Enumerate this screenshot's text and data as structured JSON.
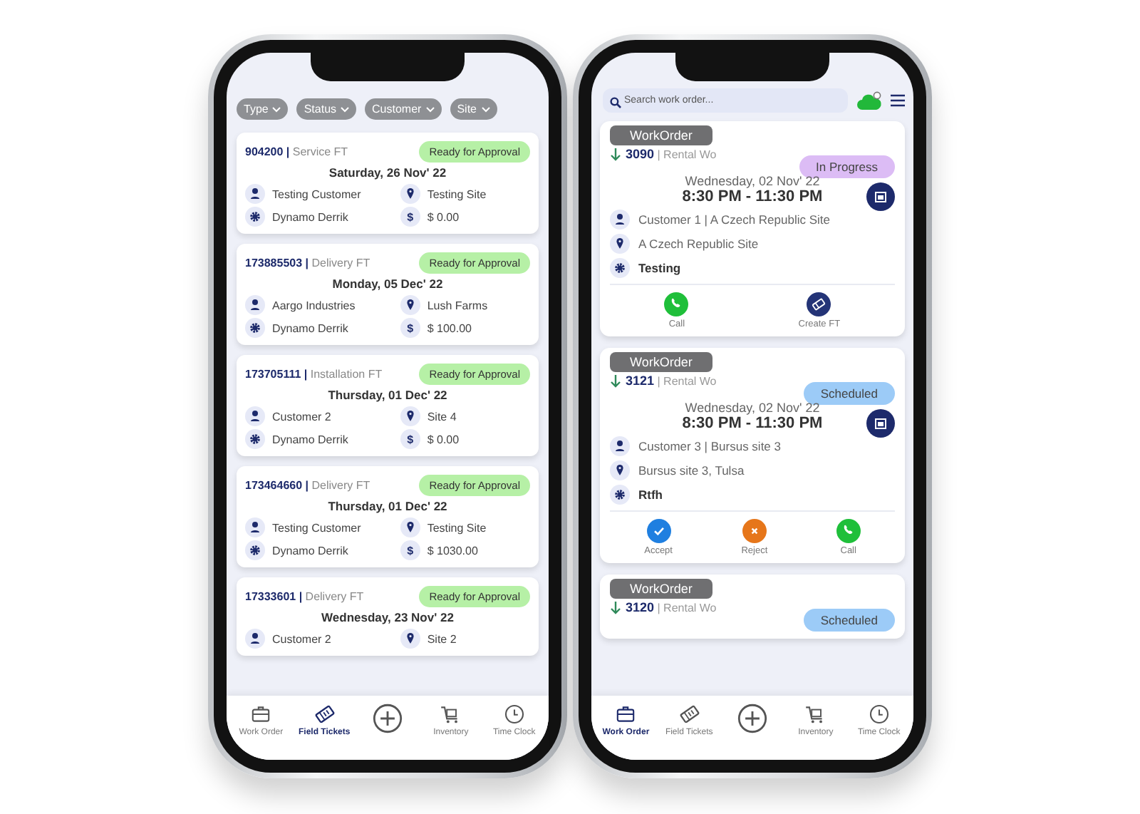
{
  "field_tickets_screen": {
    "filters": [
      "Type",
      "Status",
      "Customer",
      "Site"
    ],
    "currency_icon": "$",
    "tickets": [
      {
        "number": "904200 |",
        "type": "Service FT",
        "status": "Ready for Approval",
        "color": "#b6f0a6",
        "date": "Saturday, 26 Nov' 22",
        "customer": "Testing Customer",
        "site": "Testing Site",
        "technician": "Dynamo Derrik",
        "amount": "$ 0.00"
      },
      {
        "number": "173885503 |",
        "type": "Delivery FT",
        "status": "Ready for Approval",
        "color": "#b6f0a6",
        "date": "Monday, 05 Dec' 22",
        "customer": "Aargo Industries",
        "site": "Lush Farms",
        "technician": "Dynamo Derrik",
        "amount": "$ 100.00"
      },
      {
        "number": "173705111 |",
        "type": "Installation FT",
        "status": "Ready for Approval",
        "color": "#b6f0a6",
        "date": "Thursday, 01 Dec' 22",
        "customer": "Customer 2",
        "site": "Site 4",
        "technician": "Dynamo Derrik",
        "amount": "$ 0.00"
      },
      {
        "number": "173464660 |",
        "type": "Delivery FT",
        "status": "Ready for Approval",
        "color": "#b6f0a6",
        "date": "Thursday, 01 Dec' 22",
        "customer": "Testing Customer",
        "site": "Testing Site",
        "technician": "Dynamo Derrik",
        "amount": "$ 1030.00"
      },
      {
        "number": "17333601 |",
        "type": "Delivery FT",
        "status": "Ready for Approval",
        "color": "#b6f0a6",
        "date": "Wednesday, 23 Nov' 22",
        "customer": "Customer 2",
        "site": "Site 2"
      }
    ],
    "nav": [
      {
        "label": "Work Order",
        "kind": "briefcase",
        "selected": false
      },
      {
        "label": "Field Tickets",
        "kind": "ticket",
        "selected": true
      },
      {
        "kind": "plus",
        "selected": false
      },
      {
        "label": "Inventory",
        "kind": "cart",
        "selected": false
      },
      {
        "label": "Time Clock",
        "kind": "clock",
        "selected": false
      }
    ]
  },
  "work_orders_screen": {
    "search": {
      "placeholder": "Search work order..."
    },
    "orders": [
      {
        "tag": "WorkOrder",
        "number": "3090",
        "type": "| Rental Wo",
        "status": "In Progress",
        "color": "#dcbcf5",
        "date": "Wednesday, 02 Nov' 22",
        "time": "8:30 PM - 11:30 PM",
        "customer": "Customer 1 | A Czech Republic Site",
        "site": "A Czech Republic Site",
        "task": "Testing",
        "actions": [
          {
            "kind": "call",
            "label": "Call"
          },
          {
            "kind": "create",
            "label": "Create FT"
          }
        ]
      },
      {
        "tag": "WorkOrder",
        "number": "3121",
        "type": "| Rental Wo",
        "status": "Scheduled",
        "color": "#9ccbf7",
        "date": "Wednesday, 02 Nov' 22",
        "time": "8:30 PM - 11:30 PM",
        "customer": "Customer 3 | Bursus site 3",
        "site": "Bursus site 3, Tulsa",
        "task": "Rtfh",
        "actions": [
          {
            "kind": "accept",
            "label": "Accept"
          },
          {
            "kind": "reject",
            "label": "Reject"
          },
          {
            "kind": "call",
            "label": "Call"
          }
        ]
      },
      {
        "tag": "WorkOrder",
        "number": "3120",
        "type": "| Rental Wo",
        "status": "Scheduled",
        "color": "#9ccbf7"
      }
    ],
    "nav": [
      {
        "label": "Work Order",
        "kind": "briefcase",
        "selected": true
      },
      {
        "label": "Field Tickets",
        "kind": "ticket",
        "selected": false
      },
      {
        "kind": "plus",
        "selected": false
      },
      {
        "label": "Inventory",
        "kind": "cart",
        "selected": false
      },
      {
        "label": "Time Clock",
        "kind": "clock",
        "selected": false
      }
    ]
  }
}
